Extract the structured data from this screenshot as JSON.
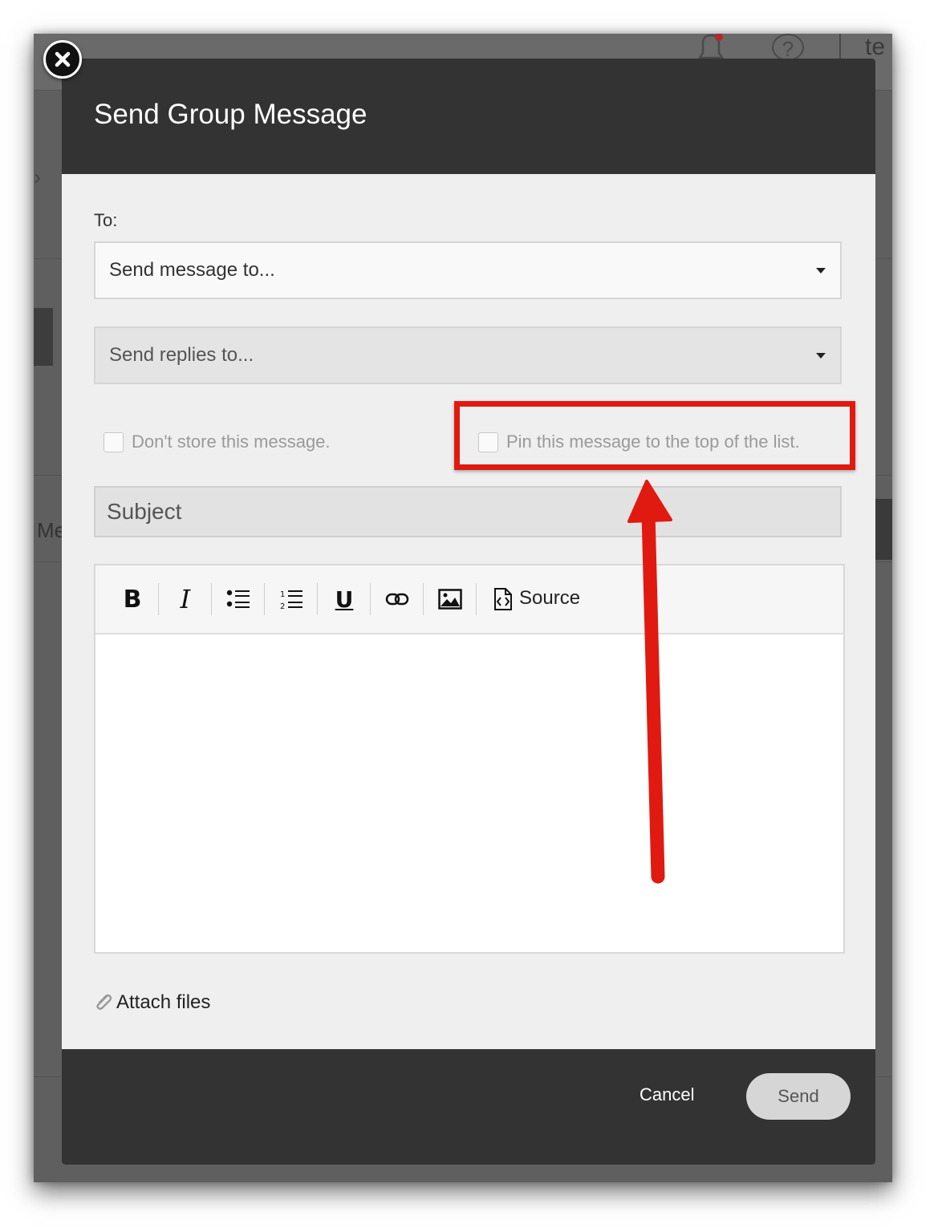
{
  "background": {
    "user_fragment": "te",
    "help_glyph": "?",
    "nav_fragment": "Me"
  },
  "modal": {
    "title": "Send Group Message",
    "to_label": "To:",
    "send_to_placeholder": "Send message to...",
    "send_replies_placeholder": "Send replies to...",
    "dont_store_label": "Don't store this message.",
    "pin_label": "Pin this message to the top of the list.",
    "subject_placeholder": "Subject",
    "toolbar": {
      "bold": "B",
      "italic": "I",
      "underline": "U",
      "source_label": "Source"
    },
    "attach_label": "Attach files",
    "cancel_label": "Cancel",
    "send_label": "Send"
  },
  "annotation": {
    "highlight_color": "#e01a10",
    "arrow_color": "#e01a10"
  },
  "colors": {
    "header_bg": "#333333",
    "body_bg": "#efefef"
  }
}
